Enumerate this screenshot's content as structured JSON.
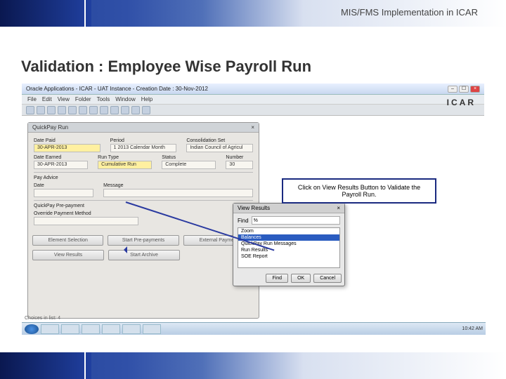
{
  "header": {
    "title": "MIS/FMS Implementation in ICAR"
  },
  "slide": {
    "title": "Validation : Employee Wise Payroll Run"
  },
  "window": {
    "title": "Oracle Applications - ICAR - UAT Instance - Creation Date : 30-Nov-2012",
    "brand": "ICAR",
    "menu": [
      "File",
      "Edit",
      "View",
      "Folder",
      "Tools",
      "Window",
      "Help"
    ]
  },
  "panel": {
    "title": "QuickPay Run",
    "date_paid_lbl": "Date Paid",
    "date_paid": "30-APR-2013",
    "period_lbl": "Period",
    "period": "1 2013 Calendar Month",
    "conset_lbl": "Consolidation Set",
    "conset": "Indian Council of Agricul",
    "date_earned_lbl": "Date Earned",
    "date_earned": "30-APR-2013",
    "run_type_lbl": "Run Type",
    "run_type": "Cumulative Run",
    "status_lbl": "Status",
    "status": "Complete",
    "number_lbl": "Number",
    "number": "30",
    "pay_advice_lbl": "Pay Advice",
    "pa_date_lbl": "Date",
    "pa_date": "",
    "pa_msg_lbl": "Message",
    "pa_msg": "",
    "prepay_title": "QuickPay Pre-payment",
    "override_lbl": "Override Payment Method",
    "override": "",
    "btn_elem": "Element Selection",
    "btn_start": "Start Pre-payments",
    "btn_ext": "External Payment",
    "btn_view": "View Results",
    "btn_arch": "Start Archive"
  },
  "dialog": {
    "title": "View Results",
    "find_lbl": "Find",
    "find_val": "%",
    "items": [
      "Zoom",
      "Balances",
      "QuickPay Run Messages",
      "Run Results",
      "SOE Report"
    ],
    "selected_index": 1,
    "btn_find": "Find",
    "btn_ok": "OK",
    "btn_cancel": "Cancel"
  },
  "callout": {
    "text": "Click on View Results Button to Validate the Payroll Run."
  },
  "statusbar": "Choices in list: 4",
  "taskbar": {
    "time": "10:42 AM"
  }
}
